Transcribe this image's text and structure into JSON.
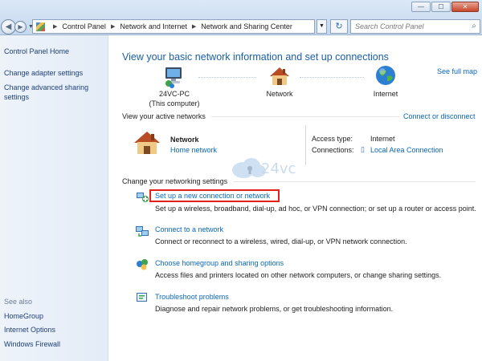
{
  "window": {
    "minimize": "—",
    "maximize": "☐",
    "close": "✕"
  },
  "nav": {
    "back_icon": "back-arrow-icon",
    "forward_icon": "forward-arrow-icon"
  },
  "breadcrumb": [
    "Control Panel",
    "Network and Internet",
    "Network and Sharing Center"
  ],
  "search": {
    "placeholder": "Search Control Panel"
  },
  "sidebar": {
    "items": [
      "Control Panel Home",
      "Change adapter settings",
      "Change advanced sharing",
      "settings"
    ],
    "see_also_label": "See also",
    "see_also": [
      "HomeGroup",
      "Internet Options",
      "Windows Firewall"
    ]
  },
  "main": {
    "heading": "View your basic network information and set up connections",
    "full_map": "See full map",
    "nodes": {
      "computer_name": "24VC-PC",
      "computer_sub": "(This computer)",
      "network": "Network",
      "internet": "Internet"
    },
    "active_label": "View your active networks",
    "connect_disconnect": "Connect or disconnect",
    "active_network": {
      "name": "Network",
      "type": "Home network",
      "access_label": "Access type:",
      "access_value": "Internet",
      "connections_label": "Connections:",
      "connections_value": "Local Area Connection"
    },
    "change_label": "Change your networking settings",
    "tasks": [
      {
        "title": "Set up a new connection or network",
        "desc": "Set up a wireless, broadband, dial-up, ad hoc, or VPN connection; or set up a router or access point."
      },
      {
        "title": "Connect to a network",
        "desc": "Connect or reconnect to a wireless, wired, dial-up, or VPN network connection."
      },
      {
        "title": "Choose homegroup and sharing options",
        "desc": "Access files and printers located on other network computers, or change sharing settings."
      },
      {
        "title": "Troubleshoot problems",
        "desc": "Diagnose and repair network problems, or get troubleshooting information."
      }
    ]
  },
  "watermark": {
    "text": "24vc"
  },
  "colors": {
    "link": "#0a66b7",
    "heading": "#1a5fa6",
    "highlight_box": "#e3211a",
    "sidebar_bg": "#e3ecf7"
  }
}
